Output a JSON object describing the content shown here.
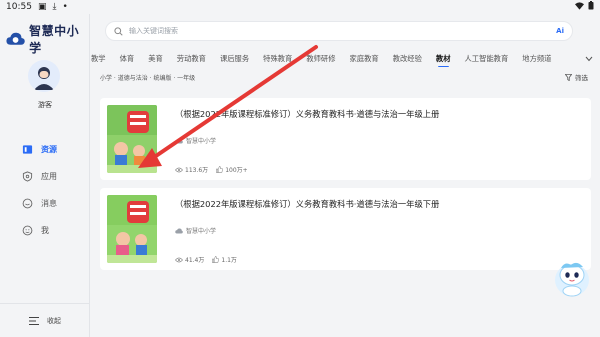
{
  "status": {
    "time": "10:55"
  },
  "app": {
    "name": "智慧中小学"
  },
  "profile": {
    "name": "游客"
  },
  "nav": {
    "items": [
      {
        "label": "资源",
        "icon": "book-icon",
        "active": true
      },
      {
        "label": "应用",
        "icon": "shield-icon",
        "active": false
      },
      {
        "label": "消息",
        "icon": "message-icon",
        "active": false
      },
      {
        "label": "我",
        "icon": "user-icon",
        "active": false
      }
    ],
    "collapse_label": "收起"
  },
  "search": {
    "placeholder": "输入关键词搜索",
    "ai_label": "Ai"
  },
  "tabs": [
    "教学",
    "体育",
    "美育",
    "劳动教育",
    "课后服务",
    "特殊教育",
    "教师研修",
    "家庭教育",
    "教改经验",
    "教材",
    "人工智能教育",
    "地方频道"
  ],
  "active_tab": "教材",
  "breadcrumb": "小学 · 道德与法治 · 统编版 · 一年级",
  "filter_label": "筛选",
  "books": [
    {
      "title": "（根据2022年版课程标准修订）义务教育教科书·道德与法治一年级上册",
      "publisher": "智慧中小学",
      "views": "113.6万",
      "likes": "100万+"
    },
    {
      "title": "（根据2022年版课程标准修订）义务教育教科书·道德与法治一年级下册",
      "publisher": "智慧中小学",
      "views": "41.4万",
      "likes": "1.1万"
    }
  ],
  "colors": {
    "accent": "#2b6cf6",
    "annotation_arrow": "#e53935"
  }
}
